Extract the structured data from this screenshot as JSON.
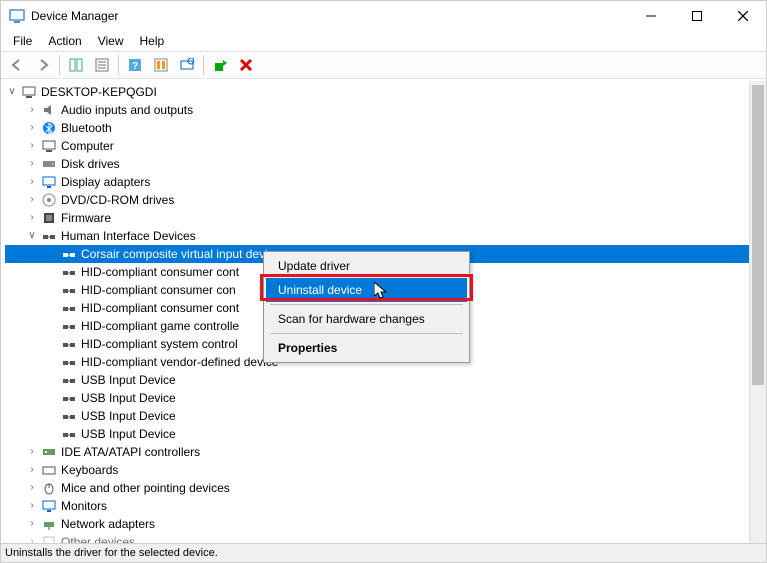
{
  "window": {
    "title": "Device Manager"
  },
  "menubar": [
    "File",
    "Action",
    "View",
    "Help"
  ],
  "root": {
    "name": "DESKTOP-KEPQGDI"
  },
  "categories": [
    {
      "name": "Audio inputs and outputs",
      "expanded": false,
      "icon": "speaker"
    },
    {
      "name": "Bluetooth",
      "expanded": false,
      "icon": "bluetooth"
    },
    {
      "name": "Computer",
      "expanded": false,
      "icon": "computer"
    },
    {
      "name": "Disk drives",
      "expanded": false,
      "icon": "disk"
    },
    {
      "name": "Display adapters",
      "expanded": false,
      "icon": "display"
    },
    {
      "name": "DVD/CD-ROM drives",
      "expanded": false,
      "icon": "dvd"
    },
    {
      "name": "Firmware",
      "expanded": false,
      "icon": "firmware"
    },
    {
      "name": "Human Interface Devices",
      "expanded": true,
      "icon": "hid",
      "children": [
        {
          "name": "Corsair composite virtual input device",
          "selected": true
        },
        {
          "name": "HID-compliant consumer control device"
        },
        {
          "name": "HID-compliant consumer control device"
        },
        {
          "name": "HID-compliant consumer control device"
        },
        {
          "name": "HID-compliant game controller"
        },
        {
          "name": "HID-compliant system controller"
        },
        {
          "name": "HID-compliant vendor-defined device"
        },
        {
          "name": "USB Input Device"
        },
        {
          "name": "USB Input Device"
        },
        {
          "name": "USB Input Device"
        },
        {
          "name": "USB Input Device"
        }
      ]
    },
    {
      "name": "IDE ATA/ATAPI controllers",
      "expanded": false,
      "icon": "ide"
    },
    {
      "name": "Keyboards",
      "expanded": false,
      "icon": "keyboard"
    },
    {
      "name": "Mice and other pointing devices",
      "expanded": false,
      "icon": "mouse"
    },
    {
      "name": "Monitors",
      "expanded": false,
      "icon": "monitor"
    },
    {
      "name": "Network adapters",
      "expanded": false,
      "icon": "network"
    },
    {
      "name": "Other devices",
      "expanded": false,
      "icon": "other"
    }
  ],
  "context_menu": {
    "items": [
      {
        "label": "Update driver"
      },
      {
        "label": "Uninstall device",
        "highlighted": true
      },
      {
        "label": "Scan for hardware changes"
      },
      {
        "label": "Properties",
        "bold": true
      }
    ]
  },
  "statusbar": "Uninstalls the driver for the selected device.",
  "truncated": {
    "child1": "HID-compliant consumer cont",
    "child2": "HID-compliant consumer con",
    "child3": "HID-compliant consumer cont",
    "child4": "HID-compliant game controlle",
    "child5": "HID-compliant system control",
    "child6": "HID-compliant vendor-defined device"
  }
}
